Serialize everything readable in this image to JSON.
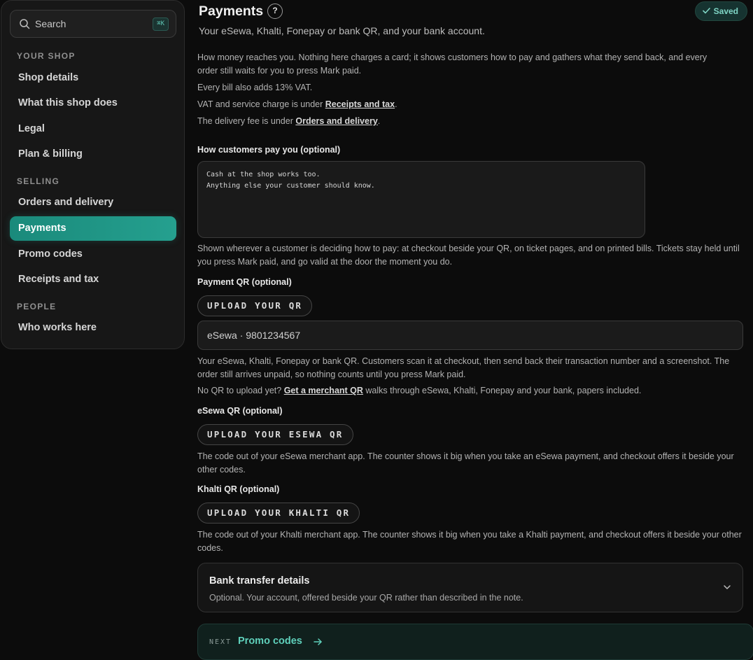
{
  "sidebar": {
    "search": {
      "label": "Search",
      "shortcut": "⌘K"
    },
    "sections": [
      {
        "title": "YOUR SHOP",
        "items": [
          "Shop details",
          "What this shop does",
          "Legal",
          "Plan & billing"
        ]
      },
      {
        "title": "SELLING",
        "items": [
          "Orders and delivery",
          "Payments",
          "Promo codes",
          "Receipts and tax"
        ]
      },
      {
        "title": "PEOPLE",
        "items": [
          "Who works here"
        ]
      }
    ],
    "active_item": "Payments"
  },
  "header": {
    "title": "Payments",
    "help": "?",
    "saved": "Saved",
    "subtitle": "Your eSewa, Khalti, Fonepay or bank QR, and your bank account."
  },
  "intro": {
    "line1": "How money reaches you. Nothing here charges a card; it shows customers how to pay and gathers what they send back, and every order still waits for you to press Mark paid.",
    "vat": "Every bill also adds 13% VAT.",
    "vat_link_prefix": "VAT and service charge is under ",
    "vat_link": "Receipts and tax",
    "vat_link_suffix": ".",
    "delivery_prefix": "The delivery fee is under ",
    "delivery_link": "Orders and delivery",
    "delivery_suffix": "."
  },
  "how_pay": {
    "label": "How customers pay you (optional)",
    "value": "Cash at the shop works too.\nAnything else your customer should know.",
    "help": "Shown wherever a customer is deciding how to pay: at checkout beside your QR, on ticket pages, and on printed bills. Tickets stay held until you press Mark paid, and go valid at the door the moment you do."
  },
  "payment_qr": {
    "label": "Payment QR (optional)",
    "button": "UPLOAD YOUR QR",
    "input_value": "eSewa · 9801234567",
    "help": "Your eSewa, Khalti, Fonepay or bank QR. Customers scan it at checkout, then send back their transaction number and a screenshot. The order still arrives unpaid, so nothing counts until you press Mark paid.",
    "merchant_prefix": "No QR to upload yet? ",
    "merchant_link": "Get a merchant QR",
    "merchant_suffix": " walks through eSewa, Khalti, Fonepay and your bank, papers included."
  },
  "esewa_qr": {
    "label": "eSewa QR (optional)",
    "button": "UPLOAD YOUR ESEWA QR",
    "help": "The code out of your eSewa merchant app. The counter shows it big when you take an eSewa payment, and checkout offers it beside your other codes."
  },
  "khalti_qr": {
    "label": "Khalti QR (optional)",
    "button": "UPLOAD YOUR KHALTI QR",
    "help": "The code out of your Khalti merchant app. The counter shows it big when you take a Khalti payment, and checkout offers it beside your other codes."
  },
  "bank": {
    "title": "Bank transfer details",
    "subtitle": "Optional. Your account, offered beside your QR rather than described in the note."
  },
  "next": {
    "label": "NEXT",
    "link": "Promo codes"
  },
  "colors": {
    "accent": "#25a08f",
    "link_accent": "#5fd0bb",
    "background": "#0c0c0c"
  },
  "icons": [
    "search-icon",
    "check-icon",
    "help-icon",
    "chevron-down-icon",
    "arrow-right-icon"
  ]
}
